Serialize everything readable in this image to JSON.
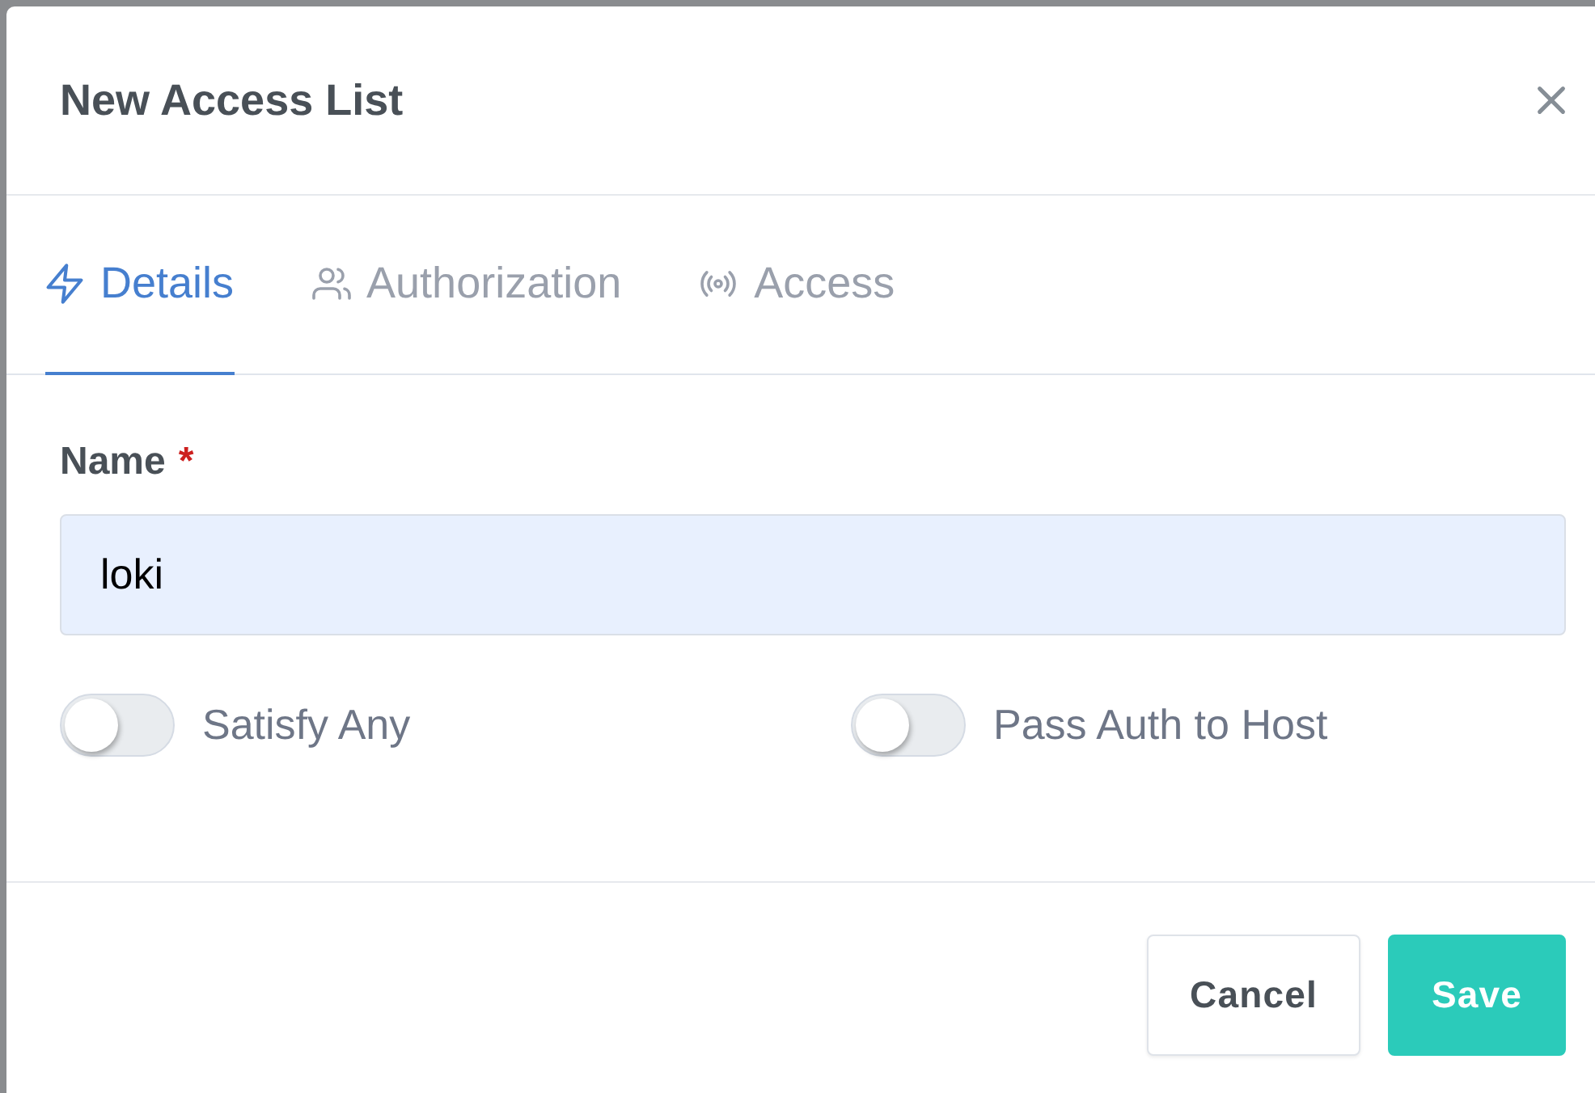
{
  "dialog": {
    "title": "New Access List"
  },
  "tabs": [
    {
      "label": "Details",
      "selected": true
    },
    {
      "label": "Authorization",
      "selected": false
    },
    {
      "label": "Access",
      "selected": false
    }
  ],
  "name_field": {
    "label": "Name",
    "required_mark": "*",
    "value": "loki",
    "autofilled": true
  },
  "switches": [
    {
      "label": "Satisfy Any",
      "on": false
    },
    {
      "label": "Pass Auth to Host",
      "on": false
    }
  ],
  "buttons": [
    {
      "label": "Cancel",
      "kind": "secondary"
    },
    {
      "label": "Save",
      "kind": "primary"
    }
  ]
}
